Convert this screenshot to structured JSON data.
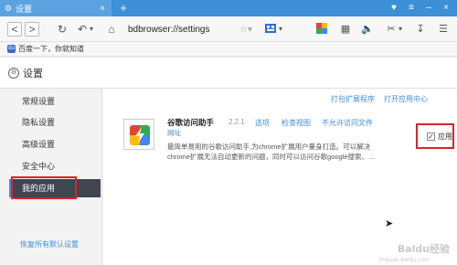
{
  "tab": {
    "title": "设置",
    "close": "×",
    "new_tab": "+"
  },
  "window_controls": {
    "skin": "♥",
    "menu": "≡",
    "minimize": "–",
    "close": "×"
  },
  "toolbar": {
    "back": "<",
    "forward": ">",
    "undo": "↶",
    "undo_menu": "▾",
    "home": "⌂",
    "reload": "↻",
    "address": "bdbrowser://settings",
    "star": "☆▾"
  },
  "bookmarks": [
    {
      "label": "百度一下，你就知道",
      "icon": "du"
    }
  ],
  "page": {
    "title": "设置"
  },
  "sidebar": {
    "items": [
      {
        "label": "常规设置",
        "active": false
      },
      {
        "label": "隐私设置",
        "active": false
      },
      {
        "label": "高级设置",
        "active": false
      },
      {
        "label": "安全中心",
        "active": false
      },
      {
        "label": "我的应用",
        "active": true
      }
    ],
    "reset": "恢复所有默认设置"
  },
  "main": {
    "pack_link": "打包扩展程序",
    "open_app_link": "打开应用中心"
  },
  "extension": {
    "name": "谷歌访问助手",
    "version": "2.2.1",
    "options_link": "选项",
    "inspect_link": "检查视图",
    "incognito_link": "不允许访问文件",
    "site_link": "网址",
    "desc_line1": "最简单易用的谷歌访问助手,为chrome扩展用户量身打造。可以解决",
    "desc_line2": "chrome扩展无法自动更新的问题，同时可以访问谷歌google搜索、...",
    "enable_label": "应用",
    "enabled": true,
    "check_mark": "✓"
  },
  "watermark": {
    "text": "Baidu经验",
    "sub": "jingyan.baidu.com"
  },
  "colors": {
    "accent": "#3d8fd6",
    "highlight": "#d9232e",
    "sidebar_active": "#3f4650"
  },
  "icons": [
    "gear-icon",
    "back-icon",
    "forward-icon",
    "undo-icon",
    "home-icon",
    "reload-icon",
    "star-icon",
    "extension-icon",
    "check-icon"
  ]
}
